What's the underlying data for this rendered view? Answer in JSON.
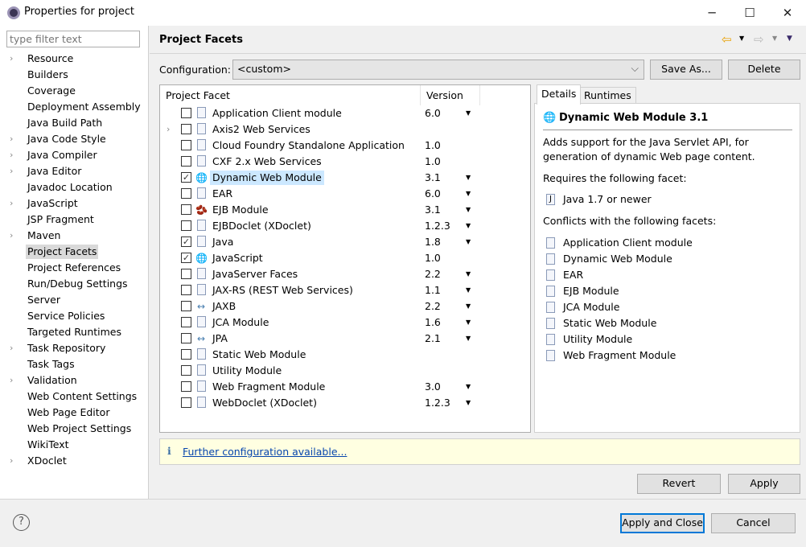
{
  "window": {
    "title": "Properties for project",
    "minimize": "─",
    "maximize": "☐",
    "close": "✕"
  },
  "sidebar": {
    "filter_placeholder": "type filter text",
    "items": [
      {
        "label": "Resource",
        "expandable": true
      },
      {
        "label": "Builders"
      },
      {
        "label": "Coverage"
      },
      {
        "label": "Deployment Assembly"
      },
      {
        "label": "Java Build Path"
      },
      {
        "label": "Java Code Style",
        "expandable": true
      },
      {
        "label": "Java Compiler",
        "expandable": true
      },
      {
        "label": "Java Editor",
        "expandable": true
      },
      {
        "label": "Javadoc Location"
      },
      {
        "label": "JavaScript",
        "expandable": true
      },
      {
        "label": "JSP Fragment"
      },
      {
        "label": "Maven",
        "expandable": true
      },
      {
        "label": "Project Facets",
        "selected": true
      },
      {
        "label": "Project References"
      },
      {
        "label": "Run/Debug Settings"
      },
      {
        "label": "Server"
      },
      {
        "label": "Service Policies"
      },
      {
        "label": "Targeted Runtimes"
      },
      {
        "label": "Task Repository",
        "expandable": true
      },
      {
        "label": "Task Tags"
      },
      {
        "label": "Validation",
        "expandable": true
      },
      {
        "label": "Web Content Settings"
      },
      {
        "label": "Web Page Editor"
      },
      {
        "label": "Web Project Settings"
      },
      {
        "label": "WikiText"
      },
      {
        "label": "XDoclet",
        "expandable": true
      }
    ]
  },
  "header": {
    "title": "Project Facets"
  },
  "config": {
    "label": "Configuration:",
    "value": "<custom>",
    "save_as": "Save As...",
    "delete": "Delete"
  },
  "table": {
    "col_facet": "Project Facet",
    "col_version": "Version",
    "rows": [
      {
        "name": "Application Client module",
        "version": "6.0",
        "checked": false,
        "icon": "document",
        "dropdown": true
      },
      {
        "name": "Axis2 Web Services",
        "version": "",
        "checked": false,
        "icon": "document",
        "expandable": true
      },
      {
        "name": "Cloud Foundry Standalone Application",
        "version": "1.0",
        "checked": false,
        "icon": "document"
      },
      {
        "name": "CXF 2.x Web Services",
        "version": "1.0",
        "checked": false,
        "icon": "document"
      },
      {
        "name": "Dynamic Web Module",
        "version": "3.1",
        "checked": true,
        "icon": "web-module",
        "dropdown": true,
        "highlighted": true
      },
      {
        "name": "EAR",
        "version": "6.0",
        "checked": false,
        "icon": "document",
        "dropdown": true
      },
      {
        "name": "EJB Module",
        "version": "3.1",
        "checked": false,
        "icon": "bean",
        "dropdown": true
      },
      {
        "name": "EJBDoclet (XDoclet)",
        "version": "1.2.3",
        "checked": false,
        "icon": "document",
        "dropdown": true
      },
      {
        "name": "Java",
        "version": "1.8",
        "checked": true,
        "icon": "document",
        "dropdown": true
      },
      {
        "name": "JavaScript",
        "version": "1.0",
        "checked": true,
        "icon": "javascript"
      },
      {
        "name": "JavaServer Faces",
        "version": "2.2",
        "checked": false,
        "icon": "document",
        "dropdown": true
      },
      {
        "name": "JAX-RS (REST Web Services)",
        "version": "1.1",
        "checked": false,
        "icon": "document",
        "dropdown": true
      },
      {
        "name": "JAXB",
        "version": "2.2",
        "checked": false,
        "icon": "arrows",
        "dropdown": true
      },
      {
        "name": "JCA Module",
        "version": "1.6",
        "checked": false,
        "icon": "document",
        "dropdown": true
      },
      {
        "name": "JPA",
        "version": "2.1",
        "checked": false,
        "icon": "arrows",
        "dropdown": true
      },
      {
        "name": "Static Web Module",
        "version": "",
        "checked": false,
        "icon": "document"
      },
      {
        "name": "Utility Module",
        "version": "",
        "checked": false,
        "icon": "document"
      },
      {
        "name": "Web Fragment Module",
        "version": "3.0",
        "checked": false,
        "icon": "document",
        "dropdown": true
      },
      {
        "name": "WebDoclet (XDoclet)",
        "version": "1.2.3",
        "checked": false,
        "icon": "document",
        "dropdown": true
      }
    ]
  },
  "details": {
    "tab_details": "Details",
    "tab_runtimes": "Runtimes",
    "title": "Dynamic Web Module 3.1",
    "desc1": "Adds support for the Java Servlet API, for",
    "desc2": "generation of dynamic Web page content.",
    "requires_label": "Requires the following facet:",
    "requires": [
      "Java 1.7 or newer"
    ],
    "conflicts_label": "Conflicts with the following facets:",
    "conflicts": [
      "Application Client module",
      "Dynamic Web Module",
      "EAR",
      "EJB Module",
      "JCA Module",
      "Static Web Module",
      "Utility Module",
      "Web Fragment Module"
    ]
  },
  "info": {
    "icon": "info-icon",
    "link": "Further configuration available..."
  },
  "buttons": {
    "revert": "Revert",
    "apply": "Apply",
    "apply_close": "Apply and Close",
    "cancel": "Cancel",
    "help": "?"
  }
}
